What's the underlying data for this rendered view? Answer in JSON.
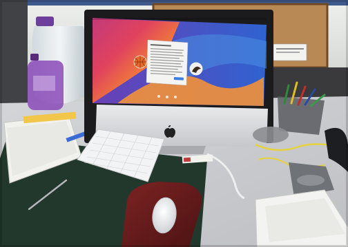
{
  "scene": {
    "subject": "imac-desk",
    "screen": {
      "state": "login-window",
      "accounts": [
        {
          "name": "",
          "icon": "basketball-avatar-icon"
        },
        {
          "name": "",
          "icon": "eagle-avatar-icon"
        }
      ],
      "dialog_visible": true
    },
    "colors": {
      "wall": "#d9dcd8",
      "desk": "#d6d6d8",
      "mat": "#23382c",
      "mousepad": "#6a1d1d",
      "cork": "#b88954",
      "wallpaper_top": "#3a63c9",
      "wallpaper_mid": "#d9436b",
      "wallpaper_bottom": "#f0a23a",
      "water_cap": "#6b3f9a"
    }
  }
}
